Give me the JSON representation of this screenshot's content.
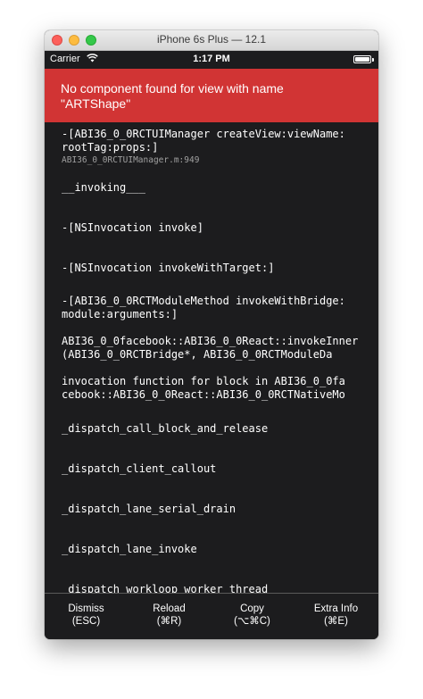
{
  "window": {
    "title": "iPhone 6s Plus — 12.1"
  },
  "statusbar": {
    "carrier": "Carrier",
    "time": "1:17 PM",
    "wifi_icon": "wifi-icon",
    "battery_icon": "battery-icon"
  },
  "error": {
    "message": "No component found for view with name \"ARTShape\""
  },
  "stack": [
    {
      "line1": "-[ABI36_0_0RCTUIManager createView:viewName:",
      "line2": "rootTag:props:]",
      "source": "ABI36_0_0RCTUIManager.m:949"
    },
    {
      "line1": "__invoking___",
      "line2": "",
      "source": ""
    },
    {
      "line1": "-[NSInvocation invoke]",
      "line2": "",
      "source": ""
    },
    {
      "line1": "-[NSInvocation invokeWithTarget:]",
      "line2": "",
      "source": ""
    },
    {
      "line1": "-[ABI36_0_0RCTModuleMethod invokeWithBridge:",
      "line2": "module:arguments:]",
      "source": ""
    },
    {
      "line1": "ABI36_0_0facebook::ABI36_0_0React::invokeInner",
      "line2": "(ABI36_0_0RCTBridge*, ABI36_0_0RCTModuleDa",
      "source": ""
    },
    {
      "line1": "invocation function for block in ABI36_0_0fa",
      "line2": "cebook::ABI36_0_0React::ABI36_0_0RCTNativeMo",
      "source": ""
    },
    {
      "line1": "_dispatch_call_block_and_release",
      "line2": "",
      "source": ""
    },
    {
      "line1": "_dispatch_client_callout",
      "line2": "",
      "source": ""
    },
    {
      "line1": "_dispatch_lane_serial_drain",
      "line2": "",
      "source": ""
    },
    {
      "line1": "_dispatch_lane_invoke",
      "line2": "",
      "source": ""
    },
    {
      "line1": "_dispatch_workloop_worker_thread",
      "line2": "",
      "source": ""
    }
  ],
  "toolbar": {
    "dismiss": {
      "label": "Dismiss",
      "shortcut": "(ESC)"
    },
    "reload": {
      "label": "Reload",
      "shortcut": "(⌘R)"
    },
    "copy": {
      "label": "Copy",
      "shortcut": "(⌥⌘C)"
    },
    "extra": {
      "label": "Extra Info",
      "shortcut": "(⌘E)"
    }
  },
  "colors": {
    "banner": "#d13434",
    "background": "#1c1c1e",
    "text": "#ffffff"
  }
}
